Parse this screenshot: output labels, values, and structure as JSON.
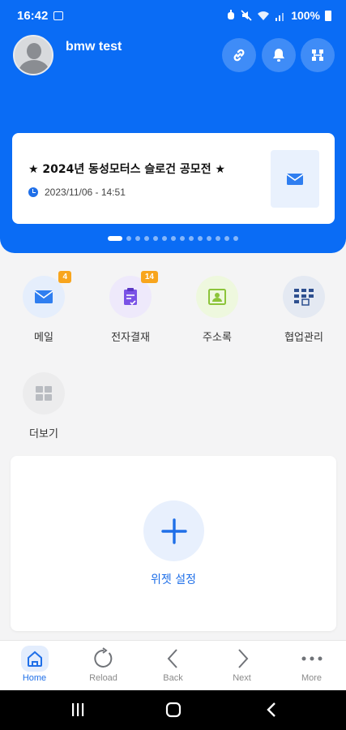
{
  "status_bar": {
    "time": "16:42",
    "battery": "100%"
  },
  "header": {
    "username": "bmw test"
  },
  "notice": {
    "title": "★ 2024년 동성모터스 슬로건 공모전 ★",
    "datetime": "2023/11/06 - 14:51"
  },
  "apps": [
    {
      "label": "메일",
      "badge": "4"
    },
    {
      "label": "전자결재",
      "badge": "14"
    },
    {
      "label": "주소록",
      "badge": ""
    },
    {
      "label": "협업관리",
      "badge": ""
    },
    {
      "label": "더보기",
      "badge": ""
    }
  ],
  "widget": {
    "label": "위젯 설정"
  },
  "bottom_nav": [
    {
      "label": "Home",
      "icon": "home-icon"
    },
    {
      "label": "Reload",
      "icon": "reload-icon"
    },
    {
      "label": "Back",
      "icon": "chevron-left-icon"
    },
    {
      "label": "Next",
      "icon": "chevron-right-icon"
    },
    {
      "label": "More",
      "icon": "more-icon"
    }
  ],
  "colors": {
    "brand": "#0a6cf5",
    "accent": "#1f6fe8",
    "badge": "#f8a51d"
  }
}
